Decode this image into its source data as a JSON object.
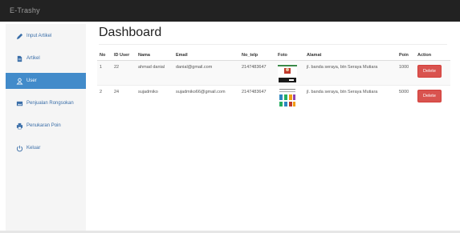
{
  "app": {
    "title": "E-Trashy"
  },
  "sidebar": {
    "items": [
      {
        "label": "Input Artikel",
        "icon": "pencil-icon",
        "active": false
      },
      {
        "label": "Artikel",
        "icon": "file-icon",
        "active": false
      },
      {
        "label": "User",
        "icon": "user-icon",
        "active": true
      },
      {
        "label": "Penjualan Rongsokan",
        "icon": "image-icon",
        "active": false
      },
      {
        "label": "Penukaran Poin",
        "icon": "print-icon",
        "active": false
      },
      {
        "label": "Keluar",
        "icon": "power-icon",
        "active": false
      }
    ]
  },
  "main": {
    "title": "Dashboard",
    "table": {
      "headers": [
        "No",
        "ID User",
        "Nama",
        "Email",
        "No_telp",
        "Foto",
        "Alamat",
        "Poin",
        "Action"
      ],
      "rows": [
        {
          "no": "1",
          "id_user": "22",
          "nama": "ahmad danial",
          "email": "danial@gmail.com",
          "no_telp": "2147483647",
          "foto": "user-photo-1",
          "alamat": "jl. banda seraya, btn Seraya Mutiara",
          "poin": "1000",
          "action": "Delete"
        },
        {
          "no": "2",
          "id_user": "24",
          "nama": "sujadmiko",
          "email": "sujadmiko66@gmail.com",
          "no_telp": "2147483647",
          "foto": "user-photo-2",
          "alamat": "jl. banda seraya, btn Seraya Mutiara",
          "poin": "5000",
          "action": "Delete"
        }
      ]
    }
  },
  "colors": {
    "topbar": "#222222",
    "sidebar_bg": "#f5f5f5",
    "active_item": "#428bca",
    "delete_button": "#d9534f"
  }
}
